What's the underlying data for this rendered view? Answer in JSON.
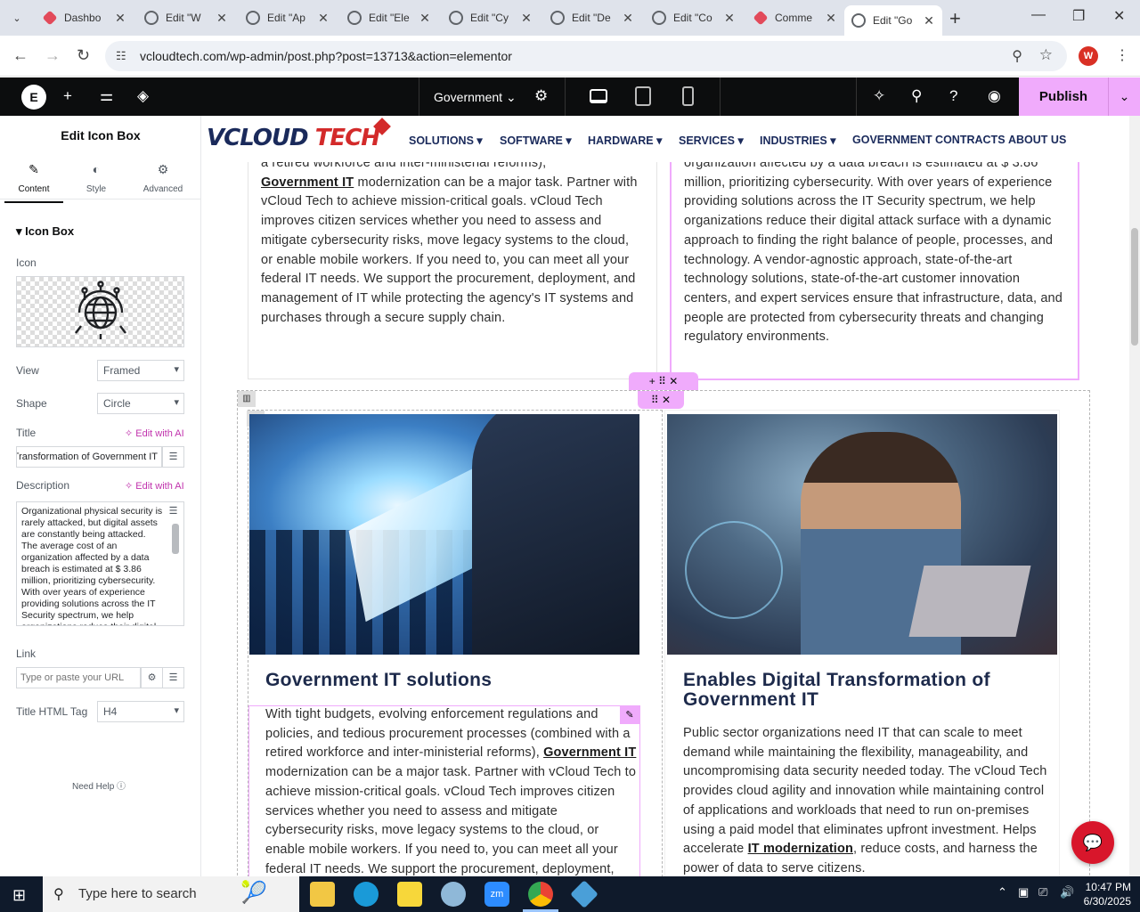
{
  "browser": {
    "tabs": [
      {
        "label": "Dashbo",
        "icon": "wordpress-icon"
      },
      {
        "label": "Edit \"W",
        "icon": "globe-icon"
      },
      {
        "label": "Edit \"Ap",
        "icon": "globe-icon"
      },
      {
        "label": "Edit \"Ele",
        "icon": "globe-icon"
      },
      {
        "label": "Edit \"Cy",
        "icon": "globe-icon"
      },
      {
        "label": "Edit \"De",
        "icon": "globe-icon"
      },
      {
        "label": "Edit \"Co",
        "icon": "globe-icon"
      },
      {
        "label": "Comme",
        "icon": "wordpress-icon"
      },
      {
        "label": "Edit \"Go",
        "icon": "globe-icon",
        "active": true
      }
    ],
    "url": "vcloudtech.com/wp-admin/post.php?post=13713&action=elementor",
    "profile_initial": "W"
  },
  "elementor": {
    "page_name": "Government",
    "publish_label": "Publish"
  },
  "panel": {
    "title": "Edit Icon Box",
    "tabs": [
      "Content",
      "Style",
      "Advanced"
    ],
    "section": "Icon Box",
    "icon_label": "Icon",
    "view_label": "View",
    "view_value": "Framed",
    "shape_label": "Shape",
    "shape_value": "Circle",
    "title_label": "Title",
    "edit_ai": "Edit with AI",
    "title_value": "Enables Digital Transformation of Government IT",
    "description_label": "Description",
    "description_value": "Organizational physical security is rarely attacked, but digital assets are constantly being attacked. The average cost of an organization affected by a data breach is estimated at $ 3.86 million, prioritizing cybersecurity. With over years of experience providing solutions across the IT Security spectrum, we help organizations reduce their digital",
    "link_label": "Link",
    "link_placeholder": "Type or paste your URL",
    "html_tag_label": "Title HTML Tag",
    "html_tag_value": "H4",
    "need_help": "Need Help"
  },
  "site": {
    "brand_main": "VCLOUD",
    "brand_second": " TECH",
    "menu": [
      "SOLUTIONS",
      "SOFTWARE",
      "HARDWARE",
      "SERVICES",
      "INDUSTRIES",
      "GOVERNMENT CONTRACTS",
      "ABOUT US"
    ],
    "top_left_pre": "a retired workforce and inter-ministerial reforms),",
    "top_left_link": "Government IT",
    "top_left_post": " modernization can be a major task. Partner with vCloud Tech to achieve mission-critical goals. vCloud Tech improves citizen services whether you need to assess and mitigate cybersecurity risks, move legacy systems to the cloud, or enable mobile workers. If you need to, you can meet all your federal IT needs. We support the procurement, deployment, and management of IT while protecting the agency's IT systems and purchases through a secure supply chain.",
    "top_right_text": "organization affected by a data breach is estimated at $ 3.86 million, prioritizing cybersecurity. With over years of experience providing solutions across the IT Security spectrum, we help organizations reduce their digital attack surface with a dynamic approach to finding the right balance of people, processes, and technology. A vendor-agnostic approach, state-of-the-art technology solutions, state-of-the-art customer innovation centers, and expert services ensure that infrastructure, data, and people are protected from cybersecurity threats and changing regulatory environments.",
    "card1_title": "Government IT solutions",
    "card1_pre": "With tight budgets, evolving enforcement regulations and policies, and tedious procurement processes (combined with a retired workforce and inter-ministerial reforms), ",
    "card1_link": "Government IT",
    "card1_post": " modernization can be a major task. Partner with vCloud Tech to achieve mission-critical goals. vCloud Tech improves citizen services whether you need to assess and mitigate cybersecurity risks, move legacy systems to the cloud, or enable mobile workers. If you need to, you can meet all your federal IT needs. We support the procurement, deployment,",
    "card2_title": "Enables Digital Transformation of Government IT",
    "card2_pre": "Public sector organizations need IT that can scale to meet demand while maintaining the flexibility, manageability, and uncompromising data security needed today. The vCloud Tech provides cloud agility and innovation while maintaining control of applications and workloads that need to run on-premises using a paid model that eliminates upfront investment. Helps accelerate ",
    "card2_link": "IT modernization",
    "card2_post": ", reduce costs, and harness the power of data to serve citizens."
  },
  "taskbar": {
    "search_placeholder": "Type here to search",
    "time": "10:47 PM",
    "date": "6/30/2025"
  }
}
